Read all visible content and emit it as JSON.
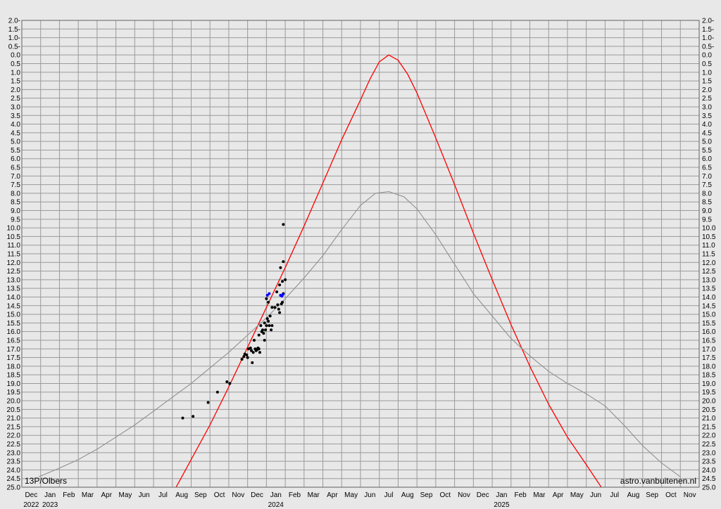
{
  "chart_data": {
    "type": "scatter",
    "title": "",
    "annotations": {
      "object_name": "13P/Olbers",
      "site": "astro.vanbuitenen.nl"
    },
    "yaxis": {
      "range_top": -2.0,
      "range_bottom": 25.0,
      "step": 0.5,
      "inverted": true,
      "labels_left": true,
      "labels_right": true,
      "tick_values": [
        -2.0,
        -1.5,
        -1.0,
        -0.5,
        0.0,
        0.5,
        1.0,
        1.5,
        2.0,
        2.5,
        3.0,
        3.5,
        4.0,
        4.5,
        5.0,
        5.5,
        6.0,
        6.5,
        7.0,
        7.5,
        8.0,
        8.5,
        9.0,
        9.5,
        10.0,
        10.5,
        11.0,
        11.5,
        12.0,
        12.5,
        13.0,
        13.5,
        14.0,
        14.5,
        15.0,
        15.5,
        16.0,
        16.5,
        17.0,
        17.5,
        18.0,
        18.5,
        19.0,
        19.5,
        20.0,
        20.5,
        21.0,
        21.5,
        22.0,
        22.5,
        23.0,
        23.5,
        24.0,
        24.5,
        25.0
      ],
      "tick_labels": [
        "2.0-",
        "1.5-",
        "1.0-",
        "0.5-",
        "0.0",
        "0.5",
        "1.0",
        "1.5",
        "2.0",
        "2.5",
        "3.0",
        "3.5",
        "4.0",
        "4.5",
        "5.0",
        "5.5",
        "6.0",
        "6.5",
        "7.0",
        "7.5",
        "8.0",
        "8.5",
        "9.0",
        "9.5",
        "10.0",
        "10.5",
        "11.0",
        "11.5",
        "12.0",
        "12.5",
        "13.0",
        "13.5",
        "14.0",
        "14.5",
        "15.0",
        "15.5",
        "16.0",
        "16.5",
        "17.0",
        "17.5",
        "18.0",
        "18.5",
        "19.0",
        "19.5",
        "20.0",
        "20.5",
        "21.0",
        "21.5",
        "22.0",
        "22.5",
        "23.0",
        "23.5",
        "24.0",
        "24.5",
        "25.0"
      ]
    },
    "xaxis": {
      "months": [
        "Dec",
        "Jan",
        "Feb",
        "Mar",
        "Apr",
        "May",
        "Jun",
        "Jul",
        "Aug",
        "Sep",
        "Oct",
        "Nov",
        "Dec",
        "Jan",
        "Feb",
        "Mar",
        "Apr",
        "May",
        "Jun",
        "Jul",
        "Aug",
        "Sep",
        "Oct",
        "Nov",
        "Dec",
        "Jan",
        "Feb",
        "Mar",
        "Apr",
        "May",
        "Jun",
        "Jul",
        "Aug",
        "Sep",
        "Oct",
        "Nov"
      ],
      "years": [
        {
          "label": "2022",
          "month_index": 0
        },
        {
          "label": "2023",
          "month_index": 1
        },
        {
          "label": "2024",
          "month_index": 13
        },
        {
          "label": "2025",
          "month_index": 25
        }
      ]
    },
    "grid": true,
    "series": [
      {
        "kind": "curve",
        "color": "#ff0000",
        "points": [
          [
            8.2,
            25.0
          ],
          [
            9.0,
            23.4
          ],
          [
            10.0,
            21.4
          ],
          [
            11.0,
            19.2
          ],
          [
            12.0,
            16.9
          ],
          [
            13.0,
            14.6
          ],
          [
            14.0,
            12.3
          ],
          [
            15.0,
            9.9
          ],
          [
            16.0,
            7.4
          ],
          [
            17.0,
            4.9
          ],
          [
            18.0,
            2.6
          ],
          [
            18.5,
            1.4
          ],
          [
            19.0,
            0.4
          ],
          [
            19.5,
            0.0
          ],
          [
            20.0,
            0.3
          ],
          [
            20.5,
            1.1
          ],
          [
            21.0,
            2.2
          ],
          [
            22.0,
            4.8
          ],
          [
            23.0,
            7.5
          ],
          [
            24.0,
            10.3
          ],
          [
            25.0,
            13.0
          ],
          [
            26.0,
            15.6
          ],
          [
            27.0,
            18.0
          ],
          [
            28.0,
            20.2
          ],
          [
            29.0,
            22.1
          ],
          [
            30.0,
            23.7
          ],
          [
            30.8,
            25.0
          ]
        ]
      },
      {
        "kind": "curve",
        "color": "#909090",
        "points": [
          [
            0.9,
            24.4
          ],
          [
            2.0,
            23.9
          ],
          [
            3.0,
            23.4
          ],
          [
            4.0,
            22.8
          ],
          [
            5.0,
            22.1
          ],
          [
            6.0,
            21.4
          ],
          [
            7.0,
            20.6
          ],
          [
            8.0,
            19.8
          ],
          [
            9.0,
            19.0
          ],
          [
            10.0,
            18.1
          ],
          [
            11.0,
            17.2
          ],
          [
            12.0,
            16.2
          ],
          [
            13.0,
            15.2
          ],
          [
            14.0,
            14.1
          ],
          [
            15.0,
            12.9
          ],
          [
            16.0,
            11.6
          ],
          [
            17.0,
            10.1
          ],
          [
            18.0,
            8.7
          ],
          [
            18.8,
            8.0
          ],
          [
            19.5,
            7.9
          ],
          [
            20.3,
            8.2
          ],
          [
            21.0,
            8.9
          ],
          [
            22.0,
            10.4
          ],
          [
            23.0,
            12.1
          ],
          [
            24.0,
            13.8
          ],
          [
            25.0,
            15.1
          ],
          [
            26.0,
            16.4
          ],
          [
            27.0,
            17.4
          ],
          [
            28.0,
            18.3
          ],
          [
            29.0,
            19.0
          ],
          [
            30.0,
            19.6
          ],
          [
            31.0,
            20.3
          ],
          [
            32.0,
            21.4
          ],
          [
            33.0,
            22.6
          ],
          [
            34.0,
            23.6
          ],
          [
            35.0,
            24.4
          ]
        ]
      },
      {
        "kind": "observations",
        "color": "#000000",
        "points": [
          [
            8.55,
            21.0
          ],
          [
            9.1,
            20.9
          ],
          [
            9.9,
            20.1
          ],
          [
            10.4,
            19.5
          ],
          [
            10.9,
            18.9
          ],
          [
            11.05,
            19.0
          ],
          [
            11.7,
            17.6
          ],
          [
            11.8,
            17.45
          ],
          [
            11.85,
            17.3
          ],
          [
            11.95,
            17.35
          ],
          [
            12.0,
            17.5
          ],
          [
            12.05,
            17.0
          ],
          [
            12.15,
            16.95
          ],
          [
            12.2,
            17.1
          ],
          [
            12.25,
            17.8
          ],
          [
            12.3,
            17.2
          ],
          [
            12.35,
            16.5
          ],
          [
            12.4,
            17.0
          ],
          [
            12.45,
            17.1
          ],
          [
            12.5,
            17.05
          ],
          [
            12.55,
            16.95
          ],
          [
            12.6,
            17.0
          ],
          [
            12.65,
            17.2
          ],
          [
            12.6,
            16.2
          ],
          [
            12.7,
            15.65
          ],
          [
            12.75,
            16.0
          ],
          [
            12.8,
            15.9
          ],
          [
            12.85,
            16.1
          ],
          [
            12.9,
            15.5
          ],
          [
            12.95,
            15.9
          ],
          [
            12.9,
            16.5
          ],
          [
            13.0,
            15.65
          ],
          [
            13.05,
            15.25
          ],
          [
            13.1,
            15.4
          ],
          [
            13.15,
            15.65
          ],
          [
            13.2,
            15.1
          ],
          [
            13.25,
            15.9
          ],
          [
            13.3,
            15.65
          ],
          [
            13.0,
            14.1
          ],
          [
            13.1,
            14.3
          ],
          [
            13.3,
            14.6
          ],
          [
            13.45,
            14.6
          ],
          [
            13.55,
            13.7
          ],
          [
            13.6,
            14.45
          ],
          [
            13.65,
            14.7
          ],
          [
            13.7,
            14.9
          ],
          [
            13.7,
            13.3
          ],
          [
            13.75,
            12.3
          ],
          [
            13.8,
            14.4
          ],
          [
            13.85,
            13.1
          ],
          [
            13.85,
            14.3
          ],
          [
            13.9,
            11.95
          ],
          [
            13.9,
            13.8
          ],
          [
            14.0,
            13.0
          ],
          [
            13.9,
            9.8
          ]
        ]
      },
      {
        "kind": "observations",
        "color": "#0000ff",
        "points": [
          [
            13.05,
            13.9
          ],
          [
            13.15,
            13.8
          ],
          [
            13.75,
            13.9
          ],
          [
            13.82,
            13.95
          ],
          [
            13.88,
            13.85
          ]
        ]
      }
    ]
  }
}
